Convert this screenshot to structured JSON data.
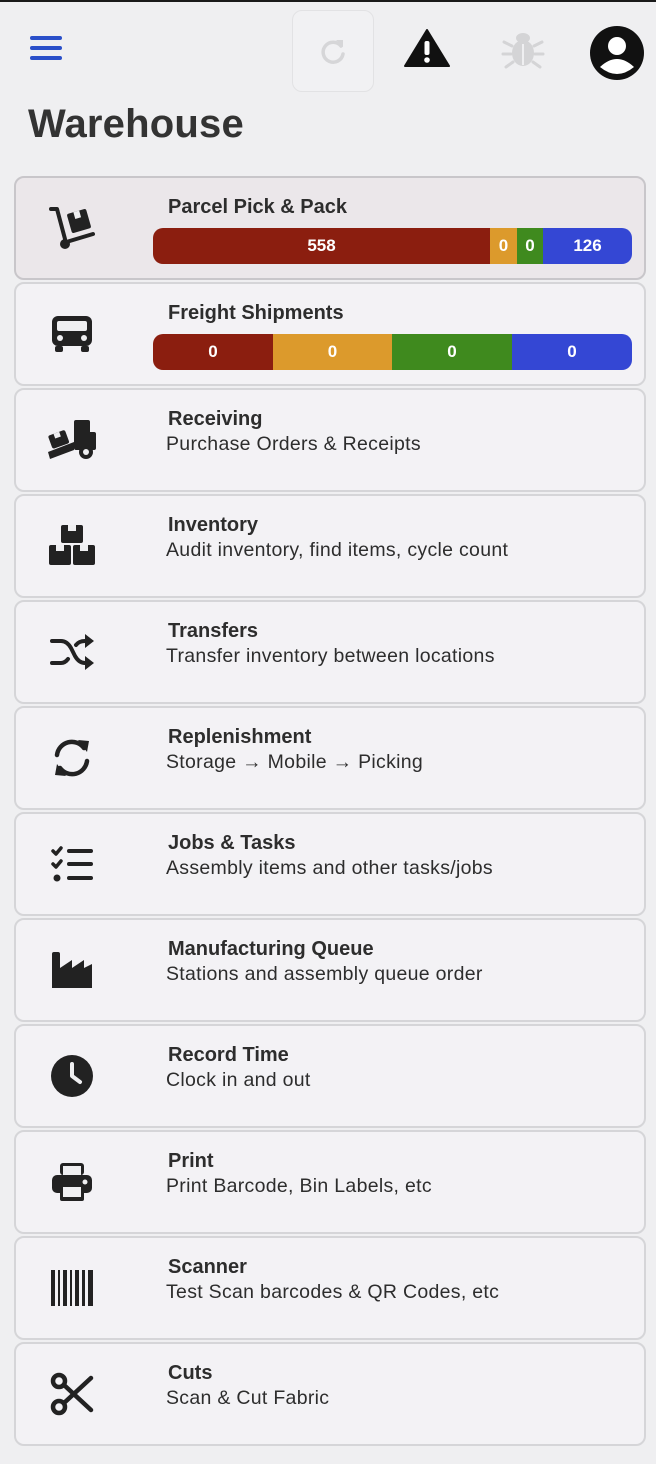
{
  "page_title": "Warehouse",
  "colors": {
    "accent": "#2a4fc9",
    "red": "#8b1e0f",
    "orange": "#dc9a2c",
    "green": "#3f8a1e",
    "blue": "#3447d4"
  },
  "topbar": {
    "icons": [
      "menu-icon",
      "refresh-icon",
      "warning-icon",
      "bug-icon",
      "user-circle-icon"
    ]
  },
  "items": [
    {
      "name": "Parcel Pick & Pack",
      "icon": "hand-truck-icon",
      "active": true,
      "bar": [
        {
          "value": "558",
          "color": "#8b1e0f",
          "width": 337
        },
        {
          "value": "0",
          "color": "#dc9a2c",
          "width": 27
        },
        {
          "value": "0",
          "color": "#3f8a1e",
          "width": 26
        },
        {
          "value": "126",
          "color": "#3447d4",
          "width": 89
        }
      ]
    },
    {
      "name": "Freight Shipments",
      "icon": "truck-icon",
      "bar": [
        {
          "value": "0",
          "color": "#8b1e0f",
          "width": 120
        },
        {
          "value": "0",
          "color": "#dc9a2c",
          "width": 119
        },
        {
          "value": "0",
          "color": "#3f8a1e",
          "width": 120
        },
        {
          "value": "0",
          "color": "#3447d4",
          "width": 120
        }
      ]
    },
    {
      "name": "Receiving",
      "desc": "Purchase Orders & Receipts",
      "icon": "truck-ramp-icon"
    },
    {
      "name": "Inventory",
      "desc": "Audit inventory, find items, cycle count",
      "icon": "boxes-icon"
    },
    {
      "name": "Transfers",
      "desc": "Transfer inventory between locations",
      "icon": "shuffle-icon"
    },
    {
      "name": "Replenishment",
      "desc": "Storage → Mobile → Picking",
      "icon": "sync-icon"
    },
    {
      "name": "Jobs & Tasks",
      "desc": "Assembly items and other tasks/jobs",
      "icon": "checklist-icon"
    },
    {
      "name": "Manufacturing Queue",
      "desc": "Stations and assembly queue order",
      "icon": "factory-icon"
    },
    {
      "name": "Record Time",
      "desc": "Clock in and out",
      "icon": "clock-icon"
    },
    {
      "name": "Print",
      "desc": "Print Barcode, Bin Labels, etc",
      "icon": "printer-icon"
    },
    {
      "name": "Scanner",
      "desc": "Test Scan barcodes & QR Codes, etc",
      "icon": "barcode-icon"
    },
    {
      "name": "Cuts",
      "desc": "Scan & Cut Fabric",
      "icon": "scissors-icon"
    }
  ]
}
